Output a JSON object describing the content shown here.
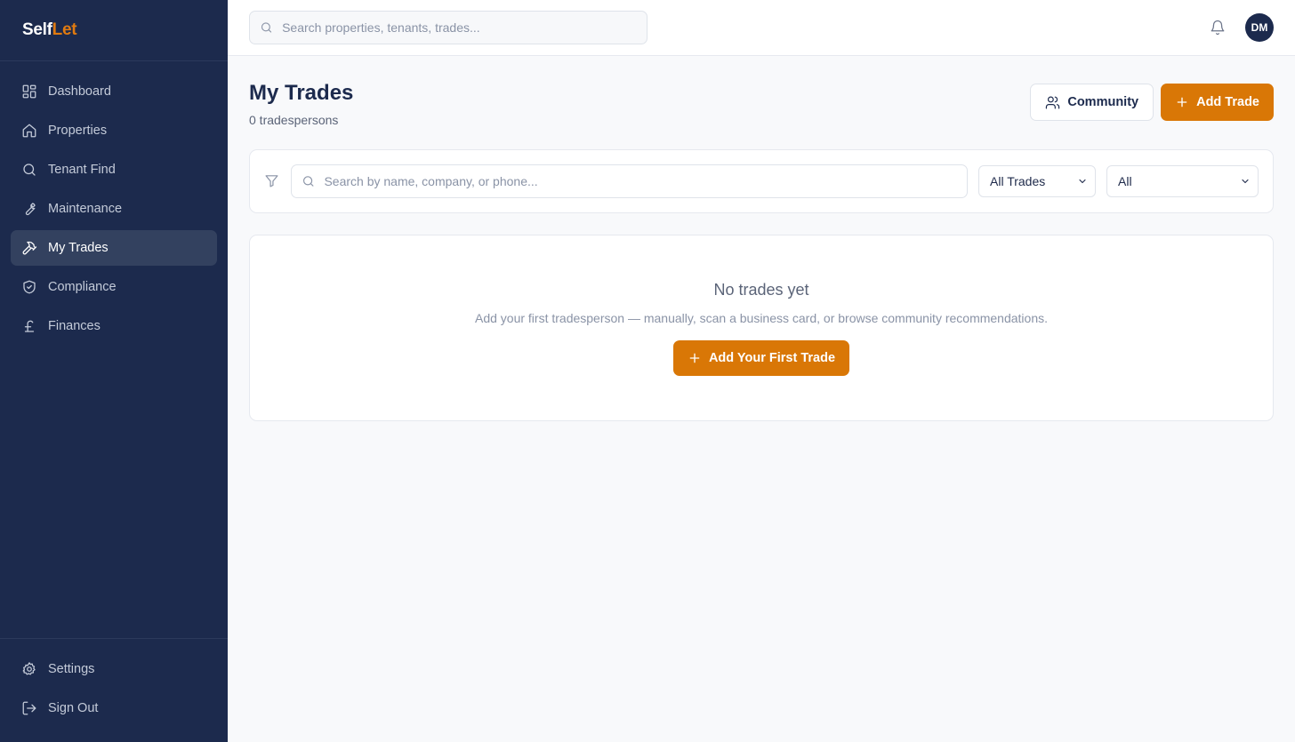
{
  "brand": {
    "part1": "Self",
    "part2": "Let"
  },
  "sidebar": {
    "items": [
      {
        "label": "Dashboard",
        "icon": "dashboard-icon"
      },
      {
        "label": "Properties",
        "icon": "home-icon"
      },
      {
        "label": "Tenant Find",
        "icon": "search-icon"
      },
      {
        "label": "Maintenance",
        "icon": "wrench-icon"
      },
      {
        "label": "My Trades",
        "icon": "hammer-icon",
        "active": true
      },
      {
        "label": "Compliance",
        "icon": "shield-check-icon"
      },
      {
        "label": "Finances",
        "icon": "pound-icon"
      }
    ],
    "bottom": [
      {
        "label": "Settings",
        "icon": "gear-icon"
      },
      {
        "label": "Sign Out",
        "icon": "sign-out-icon"
      }
    ]
  },
  "topbar": {
    "search_placeholder": "Search properties, tenants, trades...",
    "avatar_initials": "DM"
  },
  "page": {
    "title": "My Trades",
    "subtitle": "0 tradespersons",
    "community_label": "Community",
    "add_trade_label": "Add Trade"
  },
  "filters": {
    "search_placeholder": "Search by name, company, or phone...",
    "trade_select": "All Trades",
    "status_select": "All"
  },
  "empty": {
    "title": "No trades yet",
    "description": "Add your first tradesperson — manually, scan a business card, or browse community recommendations.",
    "button_label": "Add Your First Trade"
  },
  "colors": {
    "sidebar_bg": "#1c2a4d",
    "accent": "#d97706",
    "active_item_bg": "#33415f"
  }
}
